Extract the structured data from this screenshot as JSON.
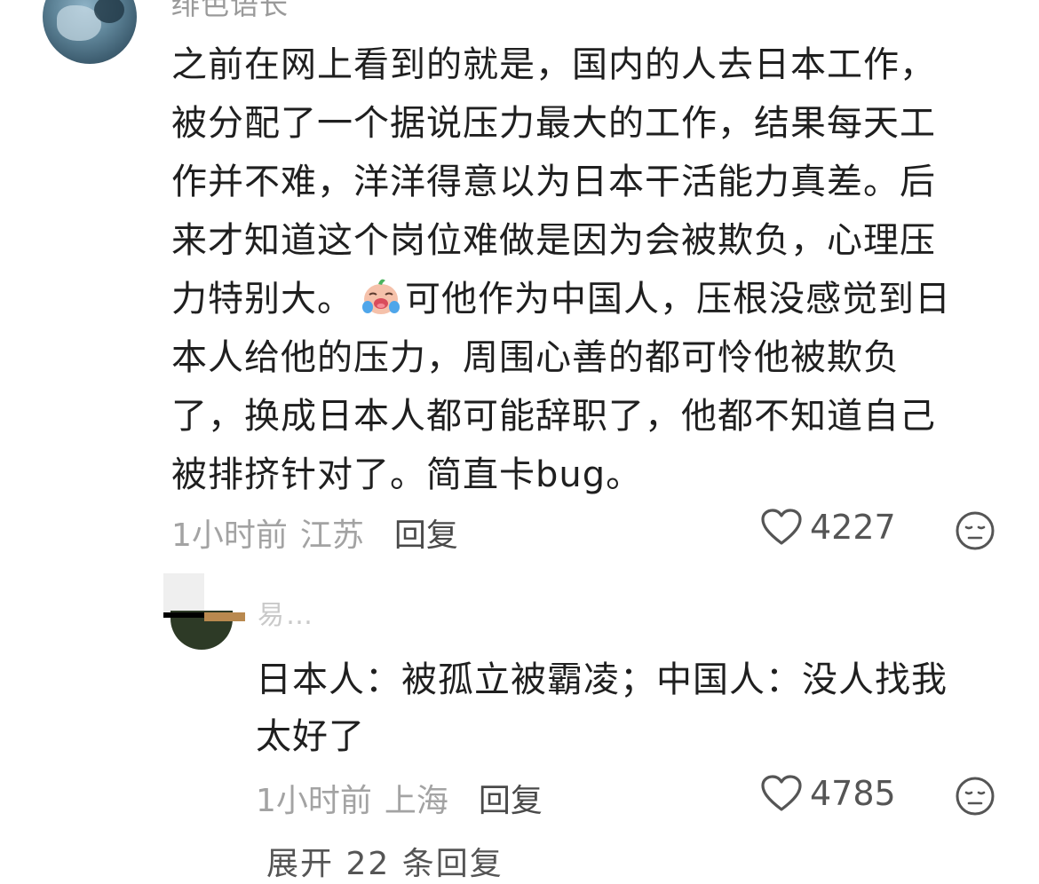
{
  "comment": {
    "username": "绯色语长",
    "lines": [
      "之前在网上看到的就是，国内的人去日本工作，",
      "被分配了一个据说压力最大的工作，结果每天工",
      "作并不难，洋洋得意以为日本干活能力真差。后",
      "来才知道这个岗位难做是因为会被欺负，心理压"
    ],
    "line5_before_emoji": "力特别大。",
    "line5_after_emoji": "可他作为中国人，压根没感觉到日",
    "lines_after": [
      "本人给他的压力，周围心善的都可怜他被欺负",
      "了，换成日本人都可能辞职了，他都不知道自己",
      "被排挤针对了。简直卡bug。"
    ],
    "emoji_icon": "crying-face-icon",
    "time": "1小时前",
    "location": "江苏",
    "reply_label": "回复",
    "likes": "4227"
  },
  "reply": {
    "username": "易…",
    "lines": [
      "日本人：被孤立被霸凌；中国人：没人找我",
      "太好了"
    ],
    "time": "1小时前",
    "location": "上海",
    "reply_label": "回复",
    "likes": "4785"
  },
  "expand_label": "展开 22 条回复",
  "colors": {
    "text_primary": "#1f1f1f",
    "text_meta": "#a3a3a3",
    "icon": "#555555"
  }
}
